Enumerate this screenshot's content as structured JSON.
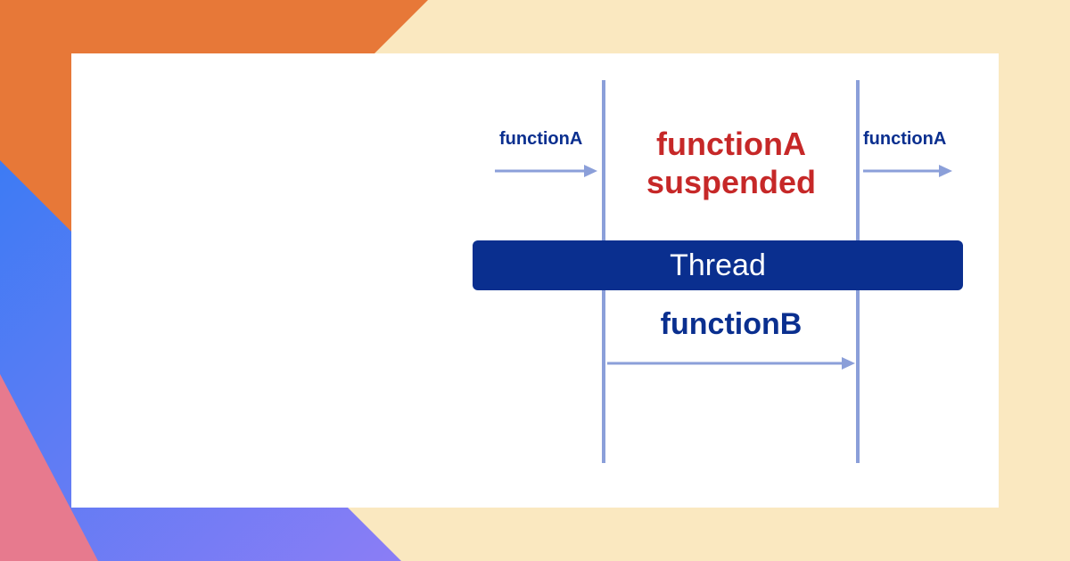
{
  "diagram": {
    "labelFunctionALeft": "functionA",
    "labelFunctionARight": "functionA",
    "suspendedLine1": "functionA",
    "suspendedLine2": "suspended",
    "threadLabel": "Thread",
    "functionBLabel": "functionB"
  },
  "colors": {
    "orange": "#e77838",
    "blue": "#3d7bf4",
    "purple": "#7b6df0",
    "pink": "#e77a8e",
    "darkBlue": "#0a2f8f",
    "red": "#c62828",
    "lightBlue": "#8b9fd9",
    "cream": "#fae8c0"
  }
}
